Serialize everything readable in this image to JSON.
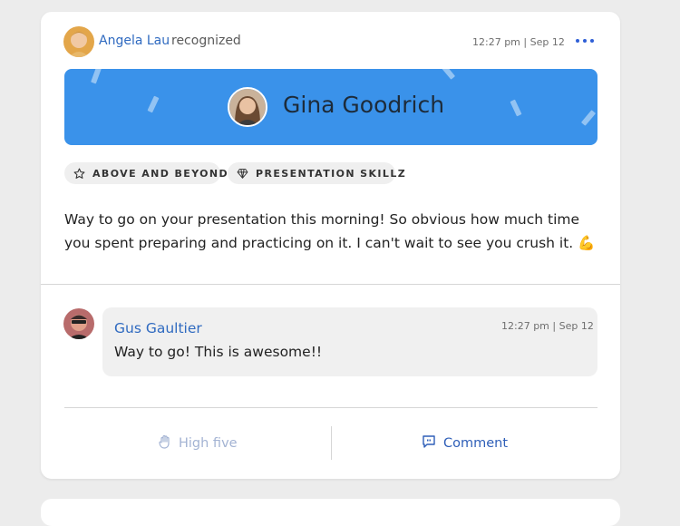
{
  "post": {
    "author": "Angela Lau",
    "verb": "recognized",
    "timestamp": "12:27 pm | Sep 12",
    "recipient": "Gina Goodrich",
    "badges": [
      "ABOVE AND BEYOND",
      "PRESENTATION SKILLZ"
    ],
    "badge_icons": [
      "star-icon",
      "diamond-icon"
    ],
    "message_line1": "Way to go on your presentation this morning! So obvious how much time",
    "message_line2": "you spent preparing and practicing on it. I can't wait to see you crush it.",
    "message_emoji": "💪"
  },
  "comment": {
    "author": "Gus Gaultier",
    "timestamp": "12:27 pm | Sep 12",
    "text": "Way to go! This is awesome!!"
  },
  "actions": {
    "high_five": "High five",
    "comment": "Comment"
  },
  "colors": {
    "banner": "#3a92ea",
    "link": "#2f6ac0",
    "more_dots": "#2f5fd6",
    "high_five_disabled": "#a3b3d3",
    "comment_action": "#2f5fb8"
  }
}
